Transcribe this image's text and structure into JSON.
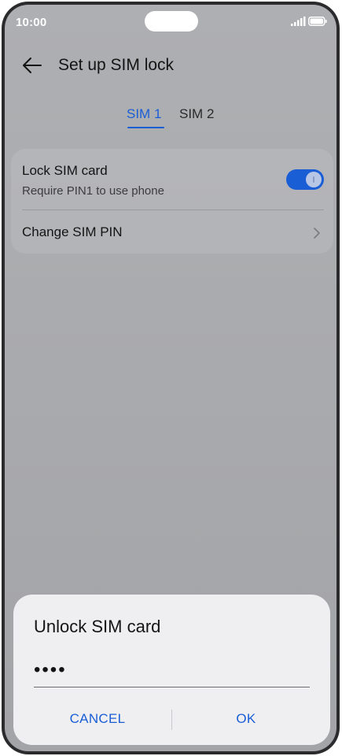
{
  "status_bar": {
    "time": "10:00",
    "signal_icon": "signal-icon",
    "battery_icon": "battery-icon"
  },
  "header": {
    "back_icon": "arrow-left-icon",
    "title": "Set up SIM lock"
  },
  "tabs": [
    {
      "label": "SIM 1",
      "selected": true
    },
    {
      "label": "SIM 2",
      "selected": false
    }
  ],
  "settings": {
    "lock_sim": {
      "title": "Lock SIM card",
      "subtitle": "Require PIN1 to use phone",
      "enabled": true
    },
    "change_pin": {
      "title": "Change SIM PIN",
      "chevron_icon": "chevron-right-icon"
    }
  },
  "dialog": {
    "title": "Unlock SIM card",
    "pin_value": "••••",
    "cancel_label": "CANCEL",
    "ok_label": "OK"
  },
  "colors": {
    "accent": "#1a5ed6",
    "background": "#aeafb2",
    "dialog_background": "#efeff1",
    "text_primary": "#141414"
  }
}
